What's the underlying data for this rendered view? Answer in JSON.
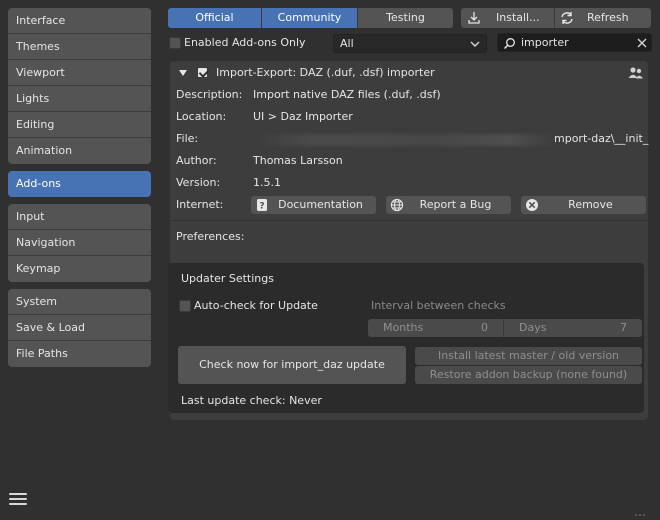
{
  "sidebar": {
    "groups": [
      [
        "Interface",
        "Themes",
        "Viewport",
        "Lights",
        "Editing",
        "Animation"
      ],
      [
        "Add-ons"
      ],
      [
        "Input",
        "Navigation",
        "Keymap"
      ],
      [
        "System",
        "Save & Load",
        "File Paths"
      ]
    ],
    "active": "Add-ons"
  },
  "filters": {
    "tabs": [
      "Official",
      "Community",
      "Testing"
    ],
    "active_tabs": [
      "Official",
      "Community"
    ],
    "install_label": "Install...",
    "refresh_label": "Refresh",
    "enabled_only_label": "Enabled Add-ons Only",
    "category_value": "All",
    "search_value": "importer"
  },
  "addon": {
    "title": "Import-Export: DAZ (.duf, .dsf) importer",
    "enabled": true,
    "description_label": "Description:",
    "description": "Import native DAZ files (.duf, .dsf)",
    "location_label": "Location:",
    "location": "UI > Daz Importer",
    "file_label": "File:",
    "file_visible_tail": "mport-daz\\__init_",
    "author_label": "Author:",
    "author": "Thomas Larsson",
    "version_label": "Version:",
    "version": "1.5.1",
    "internet_label": "Internet:",
    "documentation_label": "Documentation",
    "report_bug_label": "Report a Bug",
    "remove_label": "Remove",
    "preferences_label": "Preferences:"
  },
  "updater": {
    "title": "Updater Settings",
    "auto_check_label": "Auto-check for Update",
    "auto_check": false,
    "interval_label": "Interval between checks",
    "months_label": "Months",
    "months_value": "0",
    "days_label": "Days",
    "days_value": "7",
    "check_now_label": "Check now for import_daz update",
    "install_latest_label": "Install latest master / old version",
    "restore_label": "Restore addon backup (none found)",
    "last_check_label": "Last update check: Never"
  },
  "colors": {
    "accent": "#4772b3",
    "background": "#303030",
    "panel": "#3d3d3d",
    "button": "#545454"
  }
}
